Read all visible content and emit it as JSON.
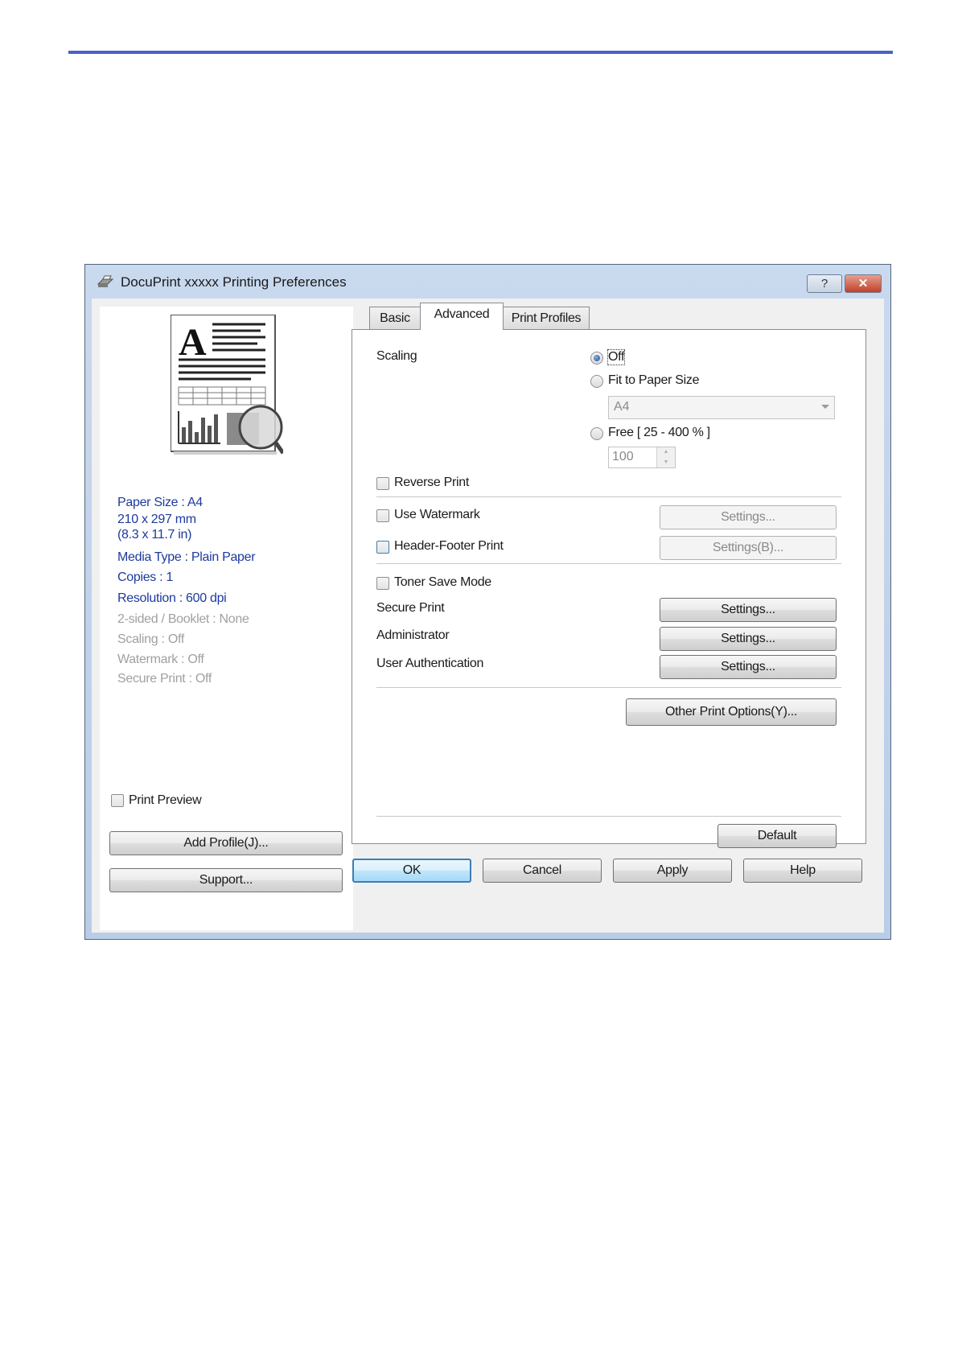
{
  "window": {
    "title": "DocuPrint xxxxx  Printing Preferences",
    "help_glyph": "?",
    "close_glyph": "✕"
  },
  "summary": {
    "paper_size": "Paper Size : A4",
    "dimensions_mm": "210 x 297 mm",
    "dimensions_in": "(8.3 x 11.7 in)",
    "media_type": "Media Type : Plain Paper",
    "copies": "Copies : 1",
    "resolution": "Resolution : 600 dpi",
    "two_sided": "2-sided / Booklet : None",
    "scaling": "Scaling : Off",
    "watermark": "Watermark : Off",
    "secure_print": "Secure Print : Off"
  },
  "left": {
    "print_preview_label": "Print Preview",
    "add_profile_label": "Add Profile(J)...",
    "support_label": "Support..."
  },
  "tabs": [
    {
      "label": "Basic",
      "selected": false
    },
    {
      "label": "Advanced",
      "selected": true
    },
    {
      "label": "Print Profiles",
      "selected": false
    }
  ],
  "advanced": {
    "scaling_label": "Scaling",
    "scaling_off": "Off",
    "fit_to_paper": "Fit to Paper Size",
    "paper_select_value": "A4",
    "free_label": "Free [ 25 - 400 % ]",
    "free_value": "100",
    "reverse_print": "Reverse Print",
    "use_watermark": "Use Watermark",
    "watermark_settings": "Settings...",
    "header_footer": "Header-Footer Print",
    "header_footer_settings": "Settings(B)...",
    "toner_save": "Toner Save Mode",
    "secure_print": "Secure Print",
    "secure_print_settings": "Settings...",
    "administrator": "Administrator",
    "administrator_settings": "Settings...",
    "user_auth": "User Authentication",
    "user_auth_settings": "Settings...",
    "other_print_options": "Other Print Options(Y)...",
    "default_label": "Default"
  },
  "footer_buttons": {
    "ok": "OK",
    "cancel": "Cancel",
    "apply": "Apply",
    "help": "Help"
  },
  "colors": {
    "rule": "#4a63c9",
    "summary_text": "#1d3a9e",
    "summary_disabled": "#a0a0a0"
  }
}
